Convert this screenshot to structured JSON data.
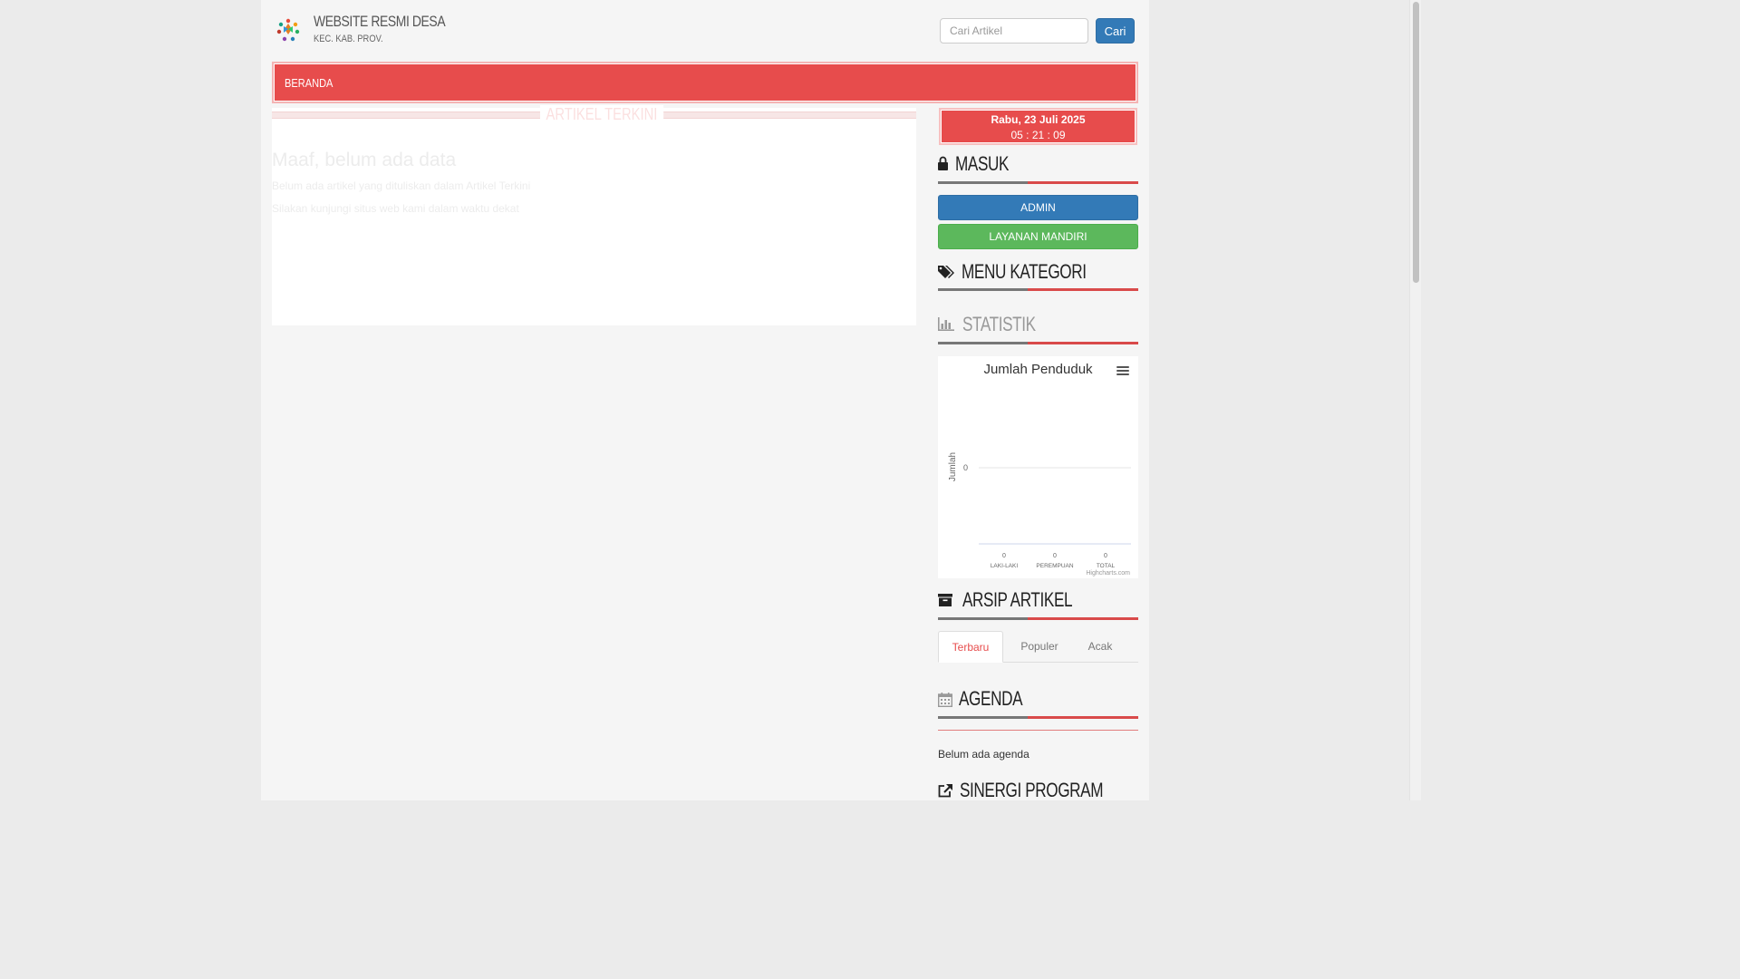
{
  "header": {
    "site_title": "WEBSITE RESMI DESA",
    "site_subtitle": "KEC. KAB. PROV.",
    "search_placeholder": "Cari Artikel",
    "search_button": "Cari"
  },
  "nav": {
    "items": [
      {
        "label": "BERANDA"
      }
    ]
  },
  "main": {
    "section_title": "ARTIKEL TERKINI",
    "empty_title": "Maaf, belum ada data",
    "empty_line1": "Belum ada artikel yang dituliskan dalam Artikel Terkini",
    "empty_line2": "Silakan kunjungi situs web kami dalam waktu dekat"
  },
  "sidebar": {
    "clock": {
      "date": "Rabu, 23 Juli 2025",
      "time": "05 : 21 : 09"
    },
    "login": {
      "title": "MASUK",
      "admin_button": "ADMIN",
      "layanan_button": "LAYANAN MANDIRI"
    },
    "kategori": {
      "title": "MENU KATEGORI"
    },
    "statistik": {
      "title": "STATISTIK"
    },
    "arsip": {
      "title": "ARSIP ARTIKEL",
      "tabs": [
        {
          "label": "Terbaru"
        },
        {
          "label": "Populer"
        },
        {
          "label": "Acak"
        }
      ]
    },
    "agenda": {
      "title": "AGENDA",
      "empty": "Belum ada agenda"
    },
    "sinergi": {
      "title": "SINERGI PROGRAM"
    }
  },
  "chart_data": {
    "type": "bar",
    "title": "Jumlah Penduduk",
    "ylabel": "Jumlah",
    "xlabel": "",
    "categories": [
      "LAKI-LAKI",
      "PEREMPUAN",
      "TOTAL"
    ],
    "values": [
      0,
      0,
      0
    ],
    "y_ticks": [
      "0"
    ],
    "credit": "Highcharts.com"
  },
  "colors": {
    "accent": "#e74c4c",
    "primary": "#337ab7",
    "success": "#5cb85c"
  }
}
